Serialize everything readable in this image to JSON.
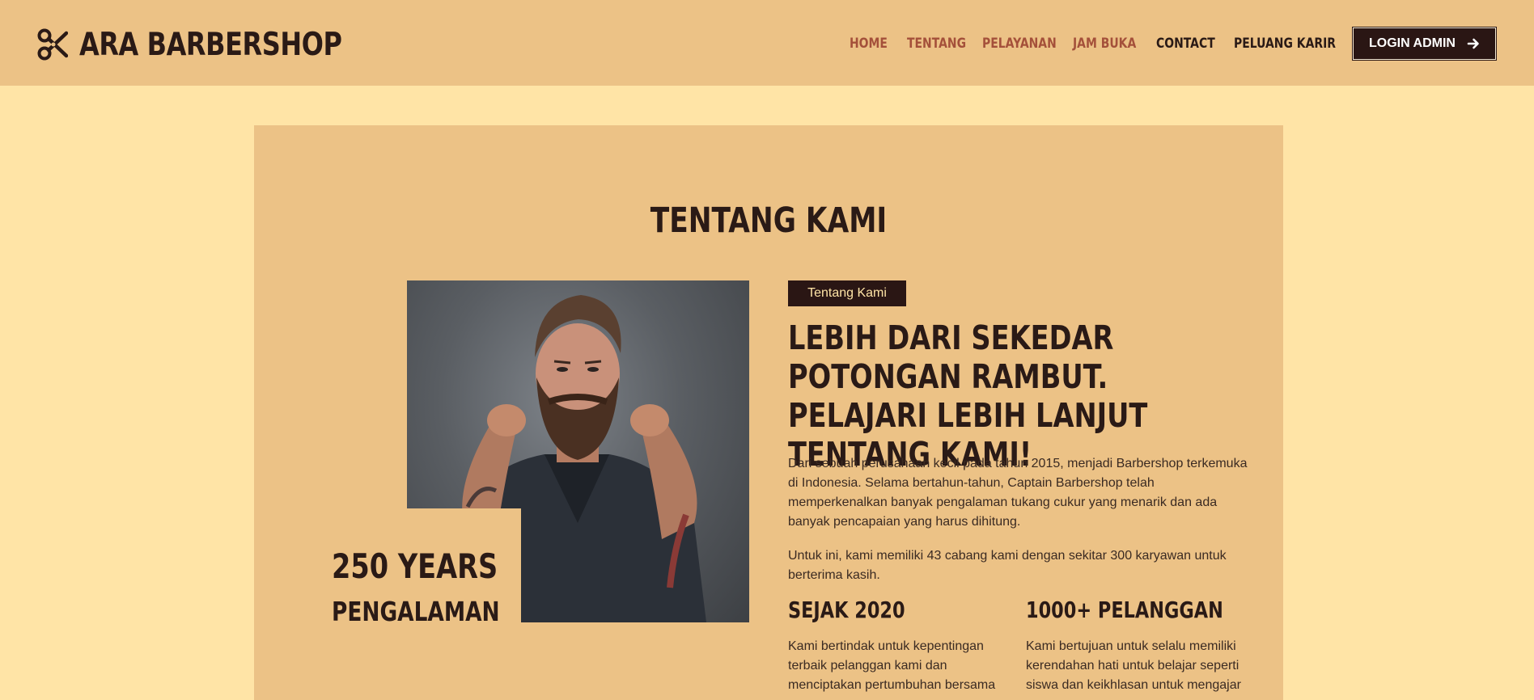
{
  "header": {
    "brand": "ARA BARBERSHOP",
    "nav": [
      {
        "label": "HOME",
        "style": "muted"
      },
      {
        "label": "TENTANG",
        "style": "muted"
      },
      {
        "label": "PELAYANAN",
        "style": "muted"
      },
      {
        "label": "JAM BUKA",
        "style": "muted"
      },
      {
        "label": "CONTACT",
        "style": "dark"
      },
      {
        "label": "PELUANG KARIR",
        "style": "dark"
      }
    ],
    "login_label": "LOGIN ADMIN"
  },
  "about": {
    "section_title": "TENTANG KAMI",
    "tag": "Tentang Kami",
    "headline": "LEBIH DARI SEKEDAR POTONGAN RAMBUT. PELAJARI LEBIH LANJUT TENTANG KAMI!",
    "paragraph_1": "Dari sebuah perusahaan kecil pada tahun 2015, menjadi Barbershop terkemuka di Indonesia. Selama bertahun-tahun, Captain Barbershop telah memperkenalkan banyak pengalaman tukang cukur yang menarik dan ada banyak pencapaian yang harus dihitung.",
    "paragraph_2": "Untuk ini, kami memiliki 43 cabang kami dengan sekitar 300 karyawan untuk berterima kasih.",
    "experience_number": "250 YEARS",
    "experience_label": "PENGALAMAN",
    "stats": [
      {
        "title": "SEJAK 2020",
        "text": "Kami bertindak untuk kepentingan terbaik pelanggan kami dan menciptakan pertumbuhan bersama"
      },
      {
        "title": "1000+ PELANGGAN",
        "text": "Kami bertujuan untuk selalu memiliki kerendahan hati untuk belajar seperti siswa dan keikhlasan untuk mengajar"
      }
    ]
  },
  "colors": {
    "page_bg": "#FFE4A6",
    "header_bg": "#ECC286",
    "card_bg": "#ECC286",
    "dark": "#2a1614",
    "nav_muted": "#A4503A"
  },
  "icons": {
    "brand": "scissors-icon",
    "login": "arrow-right-icon"
  }
}
